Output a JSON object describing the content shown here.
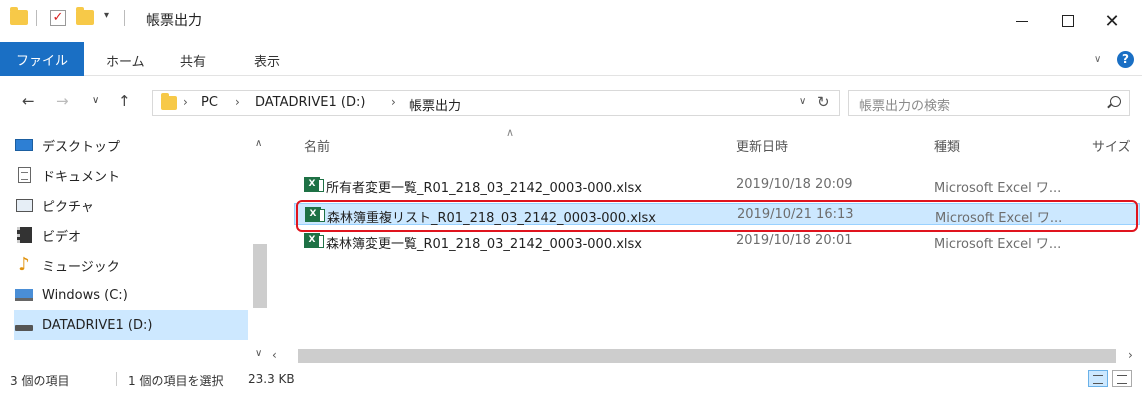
{
  "window": {
    "title": "帳票出力",
    "minimize_label": "—",
    "close_label": "✕"
  },
  "ribbon": {
    "tabs": [
      "ファイル",
      "ホーム",
      "共有",
      "表示"
    ]
  },
  "address": {
    "crumbs": [
      "PC",
      "DATADRIVE1 (D:)",
      "帳票出力"
    ],
    "search_placeholder": "帳票出力の検索"
  },
  "nav": {
    "items": [
      {
        "label": "デスクトップ",
        "icon": "desktop-icon"
      },
      {
        "label": "ドキュメント",
        "icon": "documents-icon"
      },
      {
        "label": "ピクチャ",
        "icon": "pictures-icon"
      },
      {
        "label": "ビデオ",
        "icon": "videos-icon"
      },
      {
        "label": "ミュージック",
        "icon": "music-icon"
      },
      {
        "label": "Windows (C:)",
        "icon": "windows-drive-icon"
      },
      {
        "label": "DATADRIVE1 (D:)",
        "icon": "drive-icon",
        "selected": true
      }
    ]
  },
  "columns": {
    "name": "名前",
    "modified": "更新日時",
    "type": "種類",
    "size": "サイズ"
  },
  "files": [
    {
      "name": "所有者変更一覧_R01_218_03_2142_0003-000.xlsx",
      "modified": "2019/10/18 20:09",
      "type": "Microsoft Excel ワ...",
      "selected": false
    },
    {
      "name": "森林簿重複リスト_R01_218_03_2142_0003-000.xlsx",
      "modified": "2019/10/21 16:13",
      "type": "Microsoft Excel ワ...",
      "selected": true
    },
    {
      "name": "森林簿変更一覧_R01_218_03_2142_0003-000.xlsx",
      "modified": "2019/10/18 20:01",
      "type": "Microsoft Excel ワ...",
      "selected": false
    }
  ],
  "status": {
    "item_count": "3 個の項目",
    "selection": "1 個の項目を選択",
    "size": "23.3 KB"
  },
  "colors": {
    "accent": "#1a6fc4",
    "selection": "#cce8ff",
    "highlight_box": "#e0141e",
    "excel": "#1e7145"
  }
}
